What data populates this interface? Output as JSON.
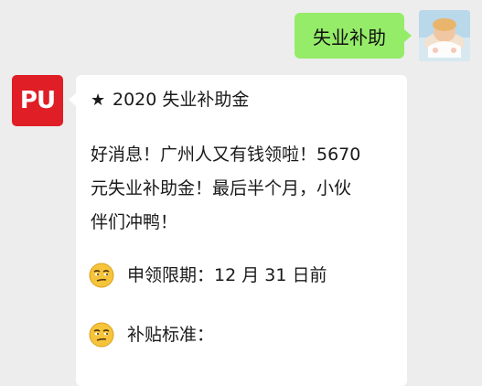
{
  "outgoing": {
    "text": "失业补助"
  },
  "incoming": {
    "avatar_text": "PU",
    "title_star": "★",
    "title": "2020 失业补助金",
    "body_lines": [
      "好消息！广州人又有钱领啦！5670",
      "元失业补助金！最后半个月，小伙",
      "伴们冲鸭！"
    ],
    "items": [
      {
        "emoji": "smirk-face-emoji",
        "text": "申领限期：12 月 31 日前"
      },
      {
        "emoji": "smirk-face-emoji",
        "text": "补贴标准："
      }
    ]
  },
  "colors": {
    "background": "#ededed",
    "outgoing_bubble": "#95ec69",
    "incoming_bubble": "#ffffff",
    "pu_avatar": "#e01e26"
  }
}
